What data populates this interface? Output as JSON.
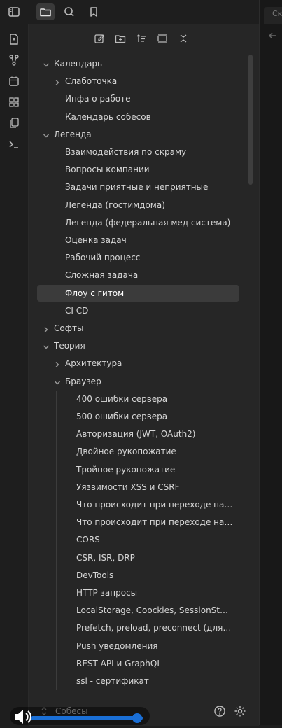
{
  "icons": {
    "sidebar_toggle": "sidebar-toggle-icon",
    "files": "folder-icon",
    "search": "search-icon",
    "bookmarks": "bookmark-icon"
  },
  "right_pane": {
    "tab_text": "Ск"
  },
  "ribbon": [
    "switcher-icon",
    "graph-icon",
    "calendar-icon",
    "canvas-icon",
    "copy-icon",
    "terminal-icon"
  ],
  "nav_buttons": [
    "new-note-icon",
    "new-folder-icon",
    "sort-icon",
    "collapse-all-icon",
    "expand-all-icon"
  ],
  "tree": [
    {
      "label": "Календарь",
      "depth": 0,
      "type": "folder",
      "open": true
    },
    {
      "label": "Слаботочка",
      "depth": 1,
      "type": "folder",
      "open": false
    },
    {
      "label": "Инфа о работе",
      "depth": 1,
      "type": "file"
    },
    {
      "label": "Календарь собесов",
      "depth": 1,
      "type": "file"
    },
    {
      "label": "Легенда",
      "depth": 0,
      "type": "folder",
      "open": true
    },
    {
      "label": "Взаимодействия по скраму",
      "depth": 1,
      "type": "file"
    },
    {
      "label": "Вопросы компании",
      "depth": 1,
      "type": "file"
    },
    {
      "label": "Задачи приятные и неприятные",
      "depth": 1,
      "type": "file"
    },
    {
      "label": "Легенда (гостимдома)",
      "depth": 1,
      "type": "file"
    },
    {
      "label": "Легенда (федеральная мед система)",
      "depth": 1,
      "type": "file"
    },
    {
      "label": "Оценка задач",
      "depth": 1,
      "type": "file"
    },
    {
      "label": "Рабочий процесс",
      "depth": 1,
      "type": "file"
    },
    {
      "label": "Сложная задача",
      "depth": 1,
      "type": "file"
    },
    {
      "label": "Флоу с гитом",
      "depth": 1,
      "type": "file",
      "selected": true
    },
    {
      "label": "CI CD",
      "depth": 1,
      "type": "file"
    },
    {
      "label": "Софты",
      "depth": 0,
      "type": "folder",
      "open": false
    },
    {
      "label": "Теория",
      "depth": 0,
      "type": "folder",
      "open": true
    },
    {
      "label": "Архитектура",
      "depth": 1,
      "type": "folder",
      "open": false
    },
    {
      "label": "Браузер",
      "depth": 1,
      "type": "folder",
      "open": true
    },
    {
      "label": "400 ошибки сервера",
      "depth": 2,
      "type": "file"
    },
    {
      "label": "500 ошибки сервера",
      "depth": 2,
      "type": "file"
    },
    {
      "label": "Авторизация (JWT, OAuth2)",
      "depth": 2,
      "type": "file"
    },
    {
      "label": "Двойное рукопожатие",
      "depth": 2,
      "type": "file"
    },
    {
      "label": "Тройное рукопожатие",
      "depth": 2,
      "type": "file"
    },
    {
      "label": "Уязвимости XSS и CSRF",
      "depth": 2,
      "type": "file"
    },
    {
      "label": "Что происходит при переходе на сайт",
      "depth": 2,
      "type": "file"
    },
    {
      "label": "Что происходит при переходе на сайт ...",
      "depth": 2,
      "type": "file"
    },
    {
      "label": "CORS",
      "depth": 2,
      "type": "file"
    },
    {
      "label": "CSR, ISR, DRP",
      "depth": 2,
      "type": "file"
    },
    {
      "label": "DevTools",
      "depth": 2,
      "type": "file"
    },
    {
      "label": "HTTP запросы",
      "depth": 2,
      "type": "file"
    },
    {
      "label": "LocalStorage, Coockies, SessionStorage, ...",
      "depth": 2,
      "type": "file"
    },
    {
      "label": "Prefetch, preload, preconnect (для link)",
      "depth": 2,
      "type": "file"
    },
    {
      "label": "Push уведомления",
      "depth": 2,
      "type": "file"
    },
    {
      "label": "REST API и GraphQL",
      "depth": 2,
      "type": "file"
    },
    {
      "label": "ssl - сертификат",
      "depth": 2,
      "type": "file"
    }
  ],
  "vault": {
    "name": "Собесы"
  },
  "volume": {
    "level": 0.95
  }
}
